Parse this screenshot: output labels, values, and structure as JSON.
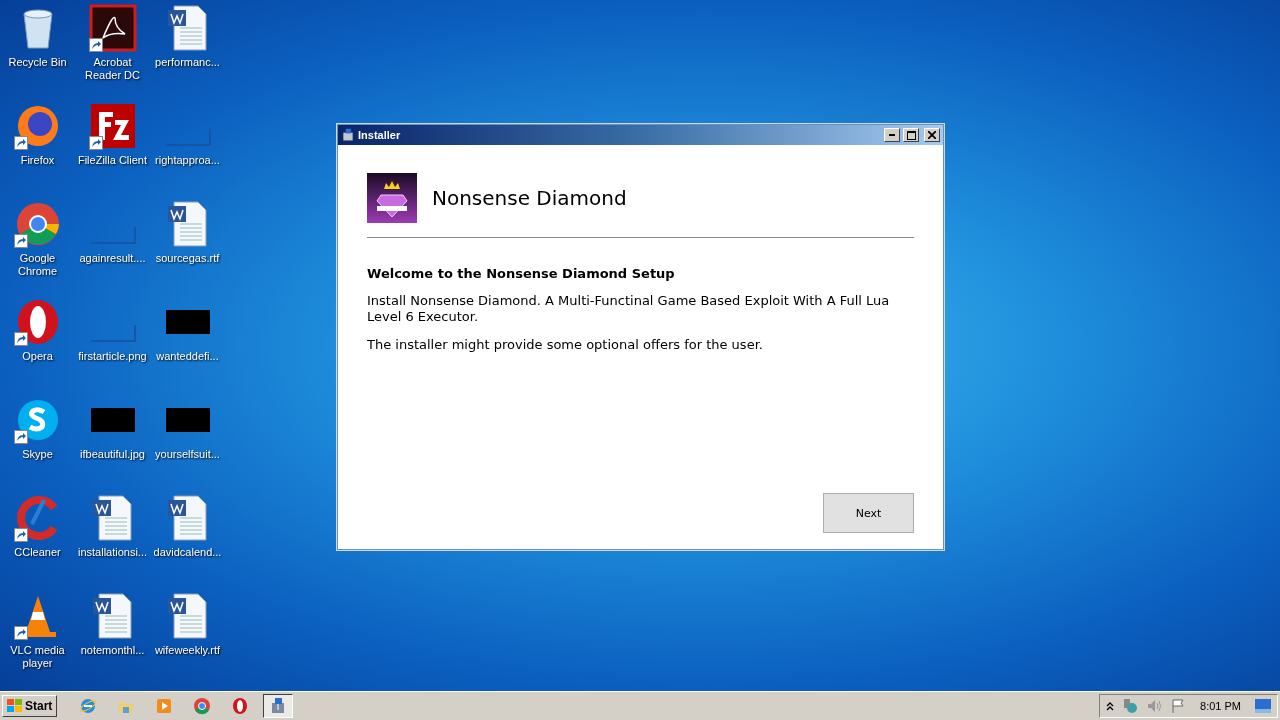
{
  "desktop_icons": [
    {
      "label": "Recycle Bin",
      "kind": "recycle",
      "shortcut": false
    },
    {
      "label": "Firefox",
      "kind": "firefox",
      "shortcut": true
    },
    {
      "label": "Google Chrome",
      "kind": "chrome",
      "shortcut": true
    },
    {
      "label": "Opera",
      "kind": "opera",
      "shortcut": true
    },
    {
      "label": "Skype",
      "kind": "skype",
      "shortcut": true
    },
    {
      "label": "CCleaner",
      "kind": "ccleaner",
      "shortcut": true
    },
    {
      "label": "VLC media player",
      "kind": "vlc",
      "shortcut": true
    },
    {
      "label": "Acrobat Reader DC",
      "kind": "acrobat",
      "shortcut": true
    },
    {
      "label": "FileZilla Client",
      "kind": "filezilla",
      "shortcut": true
    },
    {
      "label": "againresult....",
      "kind": "blank",
      "shortcut": false
    },
    {
      "label": "firstarticle.png",
      "kind": "blank",
      "shortcut": false
    },
    {
      "label": "ifbeautiful.jpg",
      "kind": "dark",
      "shortcut": false
    },
    {
      "label": "installationsi...",
      "kind": "word",
      "shortcut": false
    },
    {
      "label": "notemonthl...",
      "kind": "word",
      "shortcut": false
    },
    {
      "label": "performanc...",
      "kind": "word",
      "shortcut": false
    },
    {
      "label": "rightapproa...",
      "kind": "blank",
      "shortcut": false
    },
    {
      "label": "sourcegas.rtf",
      "kind": "word",
      "shortcut": false
    },
    {
      "label": "wanteddefi...",
      "kind": "dark",
      "shortcut": false
    },
    {
      "label": "yourselfsuit...",
      "kind": "dark",
      "shortcut": false
    },
    {
      "label": "davidcalend...",
      "kind": "word",
      "shortcut": false
    },
    {
      "label": "wifeweekly.rtf",
      "kind": "word",
      "shortcut": false
    }
  ],
  "window": {
    "title": "Installer",
    "product_name": "Nonsense Diamond",
    "heading": "Welcome to the Nonsense Diamond Setup",
    "paragraphs": [
      "Install Nonsense Diamond. A Multi-Functinal Game Based Exploit With A Full Lua Level 6 Executor.",
      "The installer might provide some optional offers for the user."
    ],
    "next_button": "Next"
  },
  "taskbar": {
    "start": "Start",
    "items": [
      {
        "kind": "ie",
        "selected": false
      },
      {
        "kind": "explorer",
        "selected": false
      },
      {
        "kind": "media",
        "selected": false
      },
      {
        "kind": "chrome",
        "selected": false
      },
      {
        "kind": "opera",
        "selected": false
      },
      {
        "kind": "installer",
        "selected": true
      }
    ],
    "clock": "8:01 PM"
  }
}
